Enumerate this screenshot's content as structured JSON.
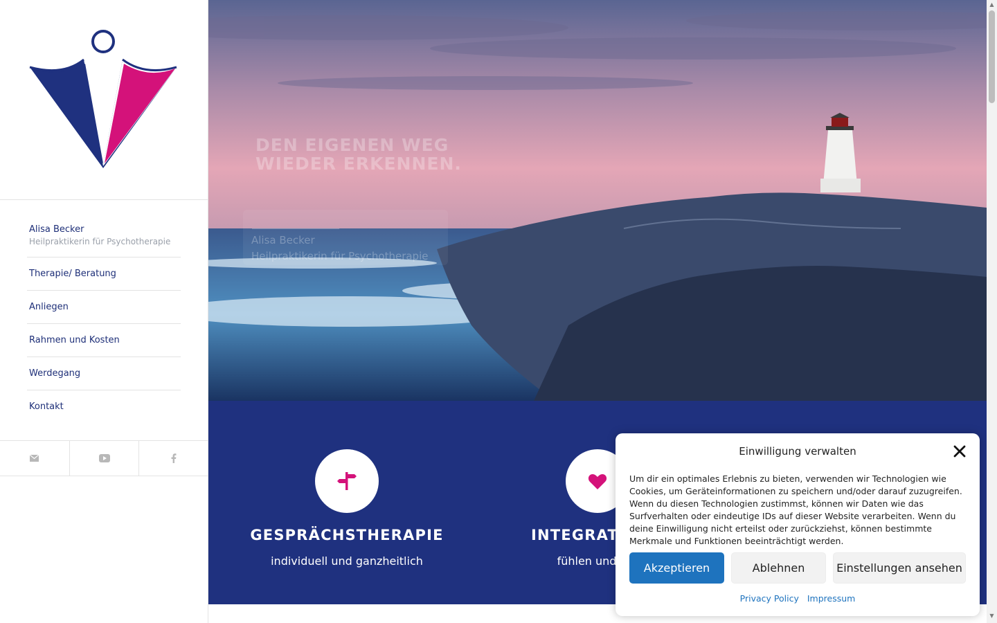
{
  "sidebar": {
    "nav": [
      {
        "label": "Alisa Becker",
        "sub": "Heilpraktikerin für Psychotherapie"
      },
      {
        "label": "Therapie/ Beratung"
      },
      {
        "label": "Anliegen"
      },
      {
        "label": "Rahmen und Kosten"
      },
      {
        "label": "Werdegang"
      },
      {
        "label": "Kontakt"
      }
    ],
    "social": [
      "mail-icon",
      "youtube-icon",
      "facebook-icon"
    ]
  },
  "hero": {
    "headline_line1": "DEN EIGENEN WEG",
    "headline_line2": "WIEDER ERKENNEN.",
    "name": "Alisa Becker",
    "subtitle": "Heilpraktikerin für Psychotherapie"
  },
  "features": [
    {
      "icon": "signpost-icon",
      "title": "GESPRÄCHSTHERAPIE",
      "subtitle": "individuell und ganzheitlich"
    },
    {
      "icon": "heart-icon",
      "title": "INTEGRATIVE T",
      "subtitle": "fühlen und ver"
    }
  ],
  "consent": {
    "title": "Einwilligung verwalten",
    "text": "Um dir ein optimales Erlebnis zu bieten, verwenden wir Technologien wie Cookies, um Geräteinformationen zu speichern und/oder darauf zuzugreifen. Wenn du diesen Technologien zustimmst, können wir Daten wie das Surfverhalten oder eindeutige IDs auf dieser Website verarbeiten. Wenn du deine Einwilligung nicht erteilst oder zurückziehst, können bestimmte Merkmale und Funktionen beeinträchtigt werden.",
    "accept": "Akzeptieren",
    "deny": "Ablehnen",
    "settings": "Einstellungen ansehen",
    "privacy": "Privacy Policy",
    "imprint": "Impressum"
  },
  "colors": {
    "brand_blue": "#1f317f",
    "brand_pink": "#d4127a",
    "accept_blue": "#1e73be"
  }
}
